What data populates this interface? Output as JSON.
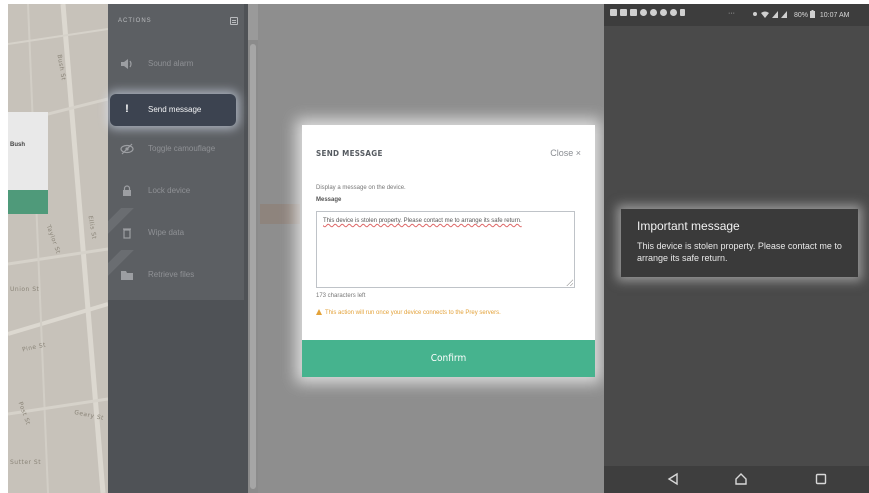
{
  "console": {
    "map": {
      "streets": [
        "Bush St",
        "Ellis St",
        "Taylor St",
        "Union St",
        "Pine St",
        "Post St",
        "Geary St",
        "Sutter St"
      ],
      "card_text": "Bush"
    },
    "actions": {
      "header": "ACTIONS",
      "items": [
        {
          "label": "Sound alarm",
          "icon": "speaker-icon"
        },
        {
          "label": "Send message",
          "icon": "exclamation-icon",
          "active": true
        },
        {
          "label": "Toggle camouflage",
          "icon": "eye-slash-icon"
        },
        {
          "label": "Lock device",
          "icon": "lock-icon"
        },
        {
          "label": "Wipe data",
          "icon": "trash-icon"
        },
        {
          "label": "Retrieve files",
          "icon": "folder-icon"
        }
      ]
    },
    "modal": {
      "title": "SEND MESSAGE",
      "close_label": "Close ×",
      "description": "Display a message on the device.",
      "field_label": "Message",
      "message_value": "This device is stolen property. Please contact me to arrange its safe return.",
      "chars_left": "173 characters left",
      "warning": "This action will run once your device connects to the Prey servers.",
      "confirm_label": "Confirm",
      "accent_color": "#46b38e",
      "warning_color": "#e3a23a"
    }
  },
  "device": {
    "status_bar": {
      "overflow": "···",
      "battery": "80%",
      "time": "10:07 AM"
    },
    "dialog": {
      "title": "Important message",
      "body": "This device is stolen property. Please contact me to arrange its safe return."
    },
    "nav": {
      "back": "back-icon",
      "home": "home-icon",
      "recent": "recent-apps-icon"
    }
  }
}
